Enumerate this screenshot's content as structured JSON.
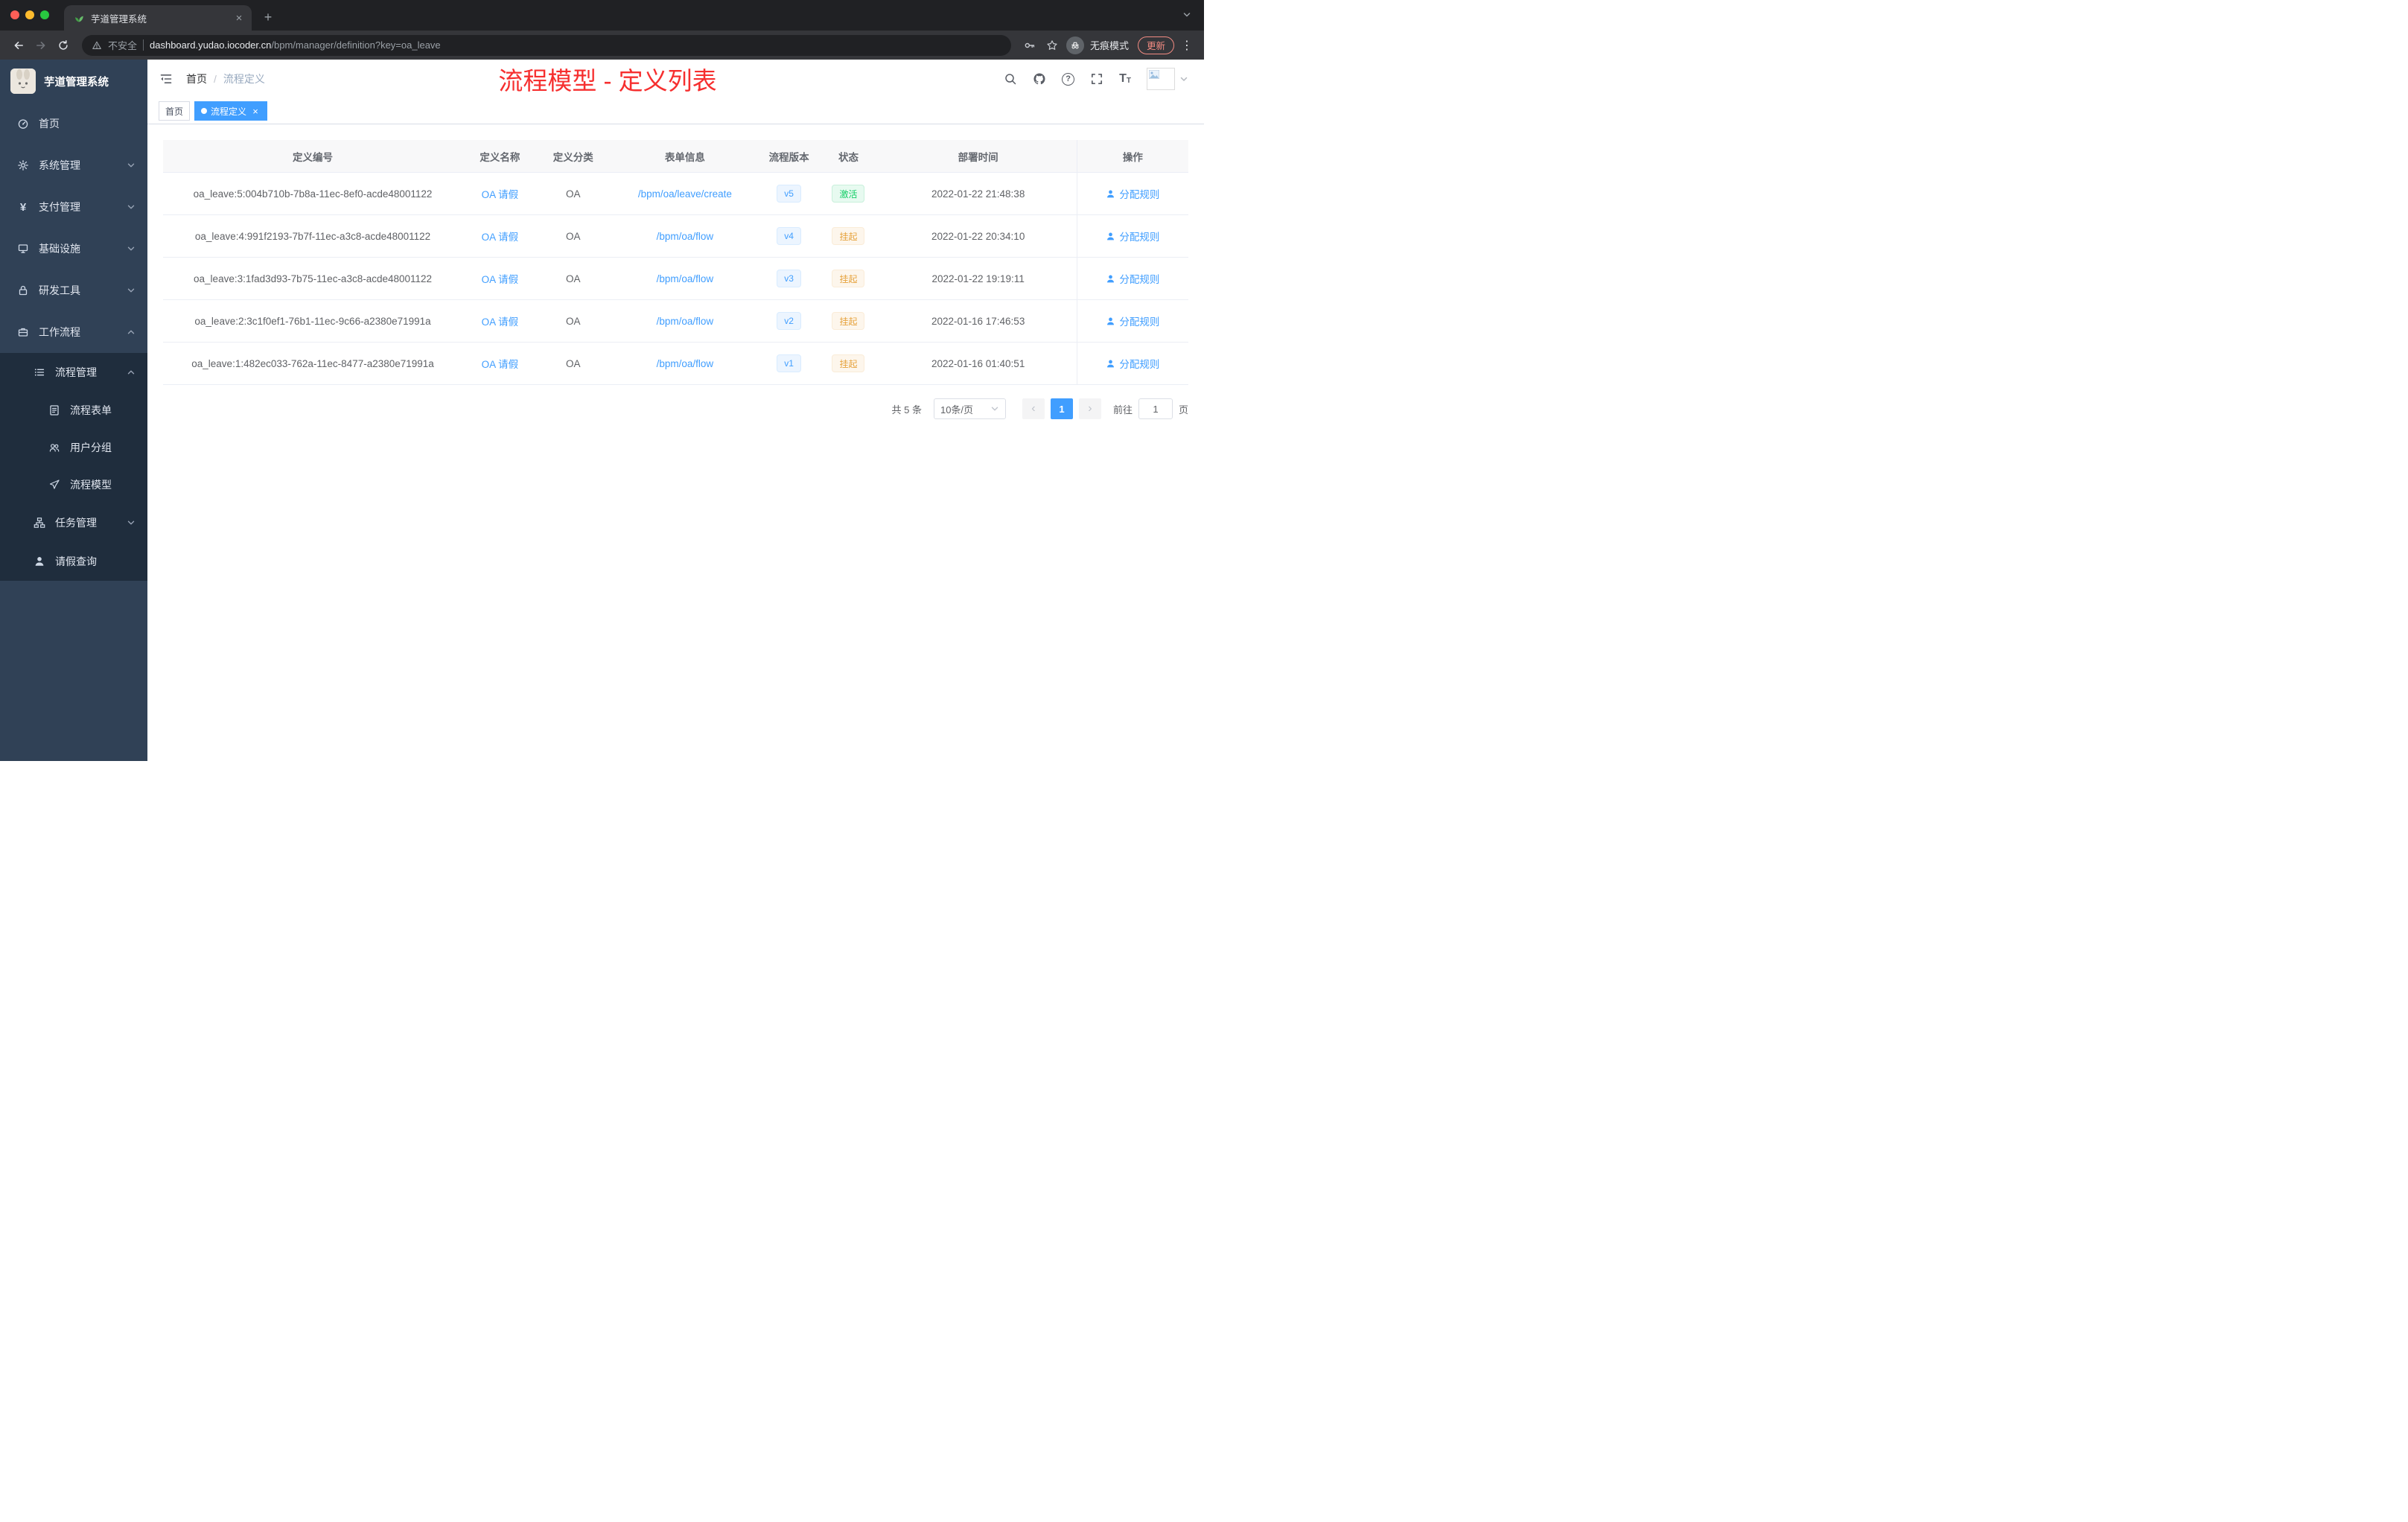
{
  "browser": {
    "tab_title": "芋道管理系统",
    "security_label": "不安全",
    "url_host": "dashboard.yudao.iocoder.cn",
    "url_path": "/bpm/manager/definition?key=oa_leave",
    "incognito_label": "无痕模式",
    "update_label": "更新"
  },
  "sidebar": {
    "app_title": "芋道管理系统",
    "menu": [
      {
        "label": "首页"
      },
      {
        "label": "系统管理"
      },
      {
        "label": "支付管理"
      },
      {
        "label": "基础设施"
      },
      {
        "label": "研发工具"
      },
      {
        "label": "工作流程"
      }
    ],
    "submenu": [
      {
        "label": "流程管理"
      },
      {
        "label": "流程表单"
      },
      {
        "label": "用户分组"
      },
      {
        "label": "流程模型"
      },
      {
        "label": "任务管理"
      },
      {
        "label": "请假查询"
      }
    ]
  },
  "header": {
    "breadcrumb_home": "首页",
    "breadcrumb_sep": "/",
    "breadcrumb_current": "流程定义",
    "annotation": "流程模型 - 定义列表"
  },
  "tags": {
    "home": "首页",
    "active": "流程定义"
  },
  "table": {
    "columns": {
      "id": "定义编号",
      "name": "定义名称",
      "category": "定义分类",
      "form": "表单信息",
      "version": "流程版本",
      "status": "状态",
      "deploy_time": "部署时间",
      "actions": "操作"
    },
    "action_label": "分配规则",
    "rows": [
      {
        "id": "oa_leave:5:004b710b-7b8a-11ec-8ef0-acde48001122",
        "name": "OA 请假",
        "category": "OA",
        "form": "/bpm/oa/leave/create",
        "version": "v5",
        "status": "激活",
        "status_type": "success",
        "deploy_time": "2022-01-22 21:48:38"
      },
      {
        "id": "oa_leave:4:991f2193-7b7f-11ec-a3c8-acde48001122",
        "name": "OA 请假",
        "category": "OA",
        "form": "/bpm/oa/flow",
        "version": "v4",
        "status": "挂起",
        "status_type": "warning",
        "deploy_time": "2022-01-22 20:34:10"
      },
      {
        "id": "oa_leave:3:1fad3d93-7b75-11ec-a3c8-acde48001122",
        "name": "OA 请假",
        "category": "OA",
        "form": "/bpm/oa/flow",
        "version": "v3",
        "status": "挂起",
        "status_type": "warning",
        "deploy_time": "2022-01-22 19:19:11"
      },
      {
        "id": "oa_leave:2:3c1f0ef1-76b1-11ec-9c66-a2380e71991a",
        "name": "OA 请假",
        "category": "OA",
        "form": "/bpm/oa/flow",
        "version": "v2",
        "status": "挂起",
        "status_type": "warning",
        "deploy_time": "2022-01-16 17:46:53"
      },
      {
        "id": "oa_leave:1:482ec033-762a-11ec-8477-a2380e71991a",
        "name": "OA 请假",
        "category": "OA",
        "form": "/bpm/oa/flow",
        "version": "v1",
        "status": "挂起",
        "status_type": "warning",
        "deploy_time": "2022-01-16 01:40:51"
      }
    ]
  },
  "pagination": {
    "total": "共 5 条",
    "page_size": "10条/页",
    "page": "1",
    "goto_label": "前往",
    "goto_value": "1",
    "page_unit": "页"
  },
  "icons": {
    "close": "×",
    "plus": "+",
    "more": "⋮",
    "question": "?",
    "font": "T",
    "yen": "¥",
    "prev": "‹",
    "next": "›"
  },
  "colors": {
    "accent": "#409eff",
    "success": "#13ce66",
    "warning": "#e6a23c",
    "annotation_red": "#f62f2f",
    "sidebar_bg": "#304156",
    "submenu_bg": "#1f2d3d"
  }
}
